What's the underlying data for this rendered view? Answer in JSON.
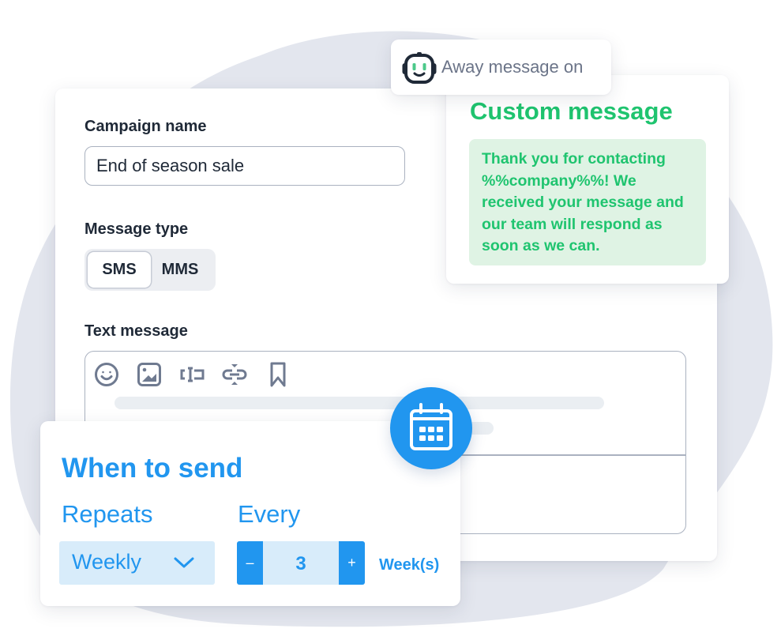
{
  "colors": {
    "background_blob": "#e3e6ee",
    "label_text": "#1f2937",
    "border": "#aab2c0",
    "custom_green": "#1fc46f",
    "custom_bubble_bg": "#dff3e4",
    "schedule_blue": "#2196ef",
    "schedule_field_bg": "#d8ecfa",
    "toolbar_icon": "#6f7a90"
  },
  "status_pill": {
    "icon": "robot-icon",
    "text": "Away message on"
  },
  "custom_message": {
    "title": "Custom message",
    "body": "Thank you for contacting %%company%%! We received your message and our team will respond as soon as we can."
  },
  "form": {
    "campaign_name": {
      "label": "Campaign name",
      "value": "End of season sale"
    },
    "message_type": {
      "label": "Message type",
      "options": [
        "SMS",
        "MMS"
      ],
      "selected": "SMS"
    },
    "text_message": {
      "label": "Text message",
      "toolbar": [
        {
          "icon": "emoji-icon",
          "name": "Emoji"
        },
        {
          "icon": "image-icon",
          "name": "Image"
        },
        {
          "icon": "text-field-icon",
          "name": "Insert field"
        },
        {
          "icon": "link-icon",
          "name": "Link"
        },
        {
          "icon": "bookmark-icon",
          "name": "Bookmark"
        }
      ]
    }
  },
  "schedule": {
    "icon": "calendar-icon",
    "title": "When to send",
    "repeats": {
      "label": "Repeats",
      "value": "Weekly"
    },
    "every": {
      "label": "Every",
      "minus_label": "–",
      "value": "3",
      "plus_label": "+",
      "unit": "Week(s)"
    }
  }
}
